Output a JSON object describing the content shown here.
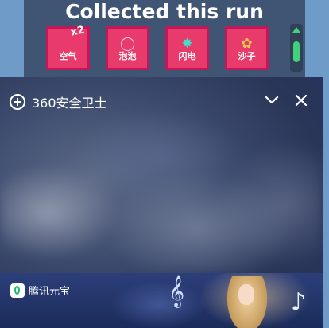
{
  "game": {
    "title": "Collected this run",
    "items": [
      {
        "label": "空气",
        "glyph": "",
        "badge": "x2",
        "color": "#e83a6b"
      },
      {
        "label": "泡泡",
        "glyph": "◯",
        "badge": "",
        "color": "#e83a6b"
      },
      {
        "label": "闪电",
        "glyph": "✸",
        "badge": "",
        "color": "#e83a6b"
      },
      {
        "label": "沙子",
        "glyph": "✿",
        "badge": "",
        "color": "#e83a6b"
      }
    ],
    "scroll_accent": "#3fd27a"
  },
  "ad": {
    "title": "360安全卫士",
    "collapse_icon": "chevron-down-icon",
    "close_icon": "close-icon",
    "banner": {
      "brand": "腾讯元宝"
    }
  }
}
